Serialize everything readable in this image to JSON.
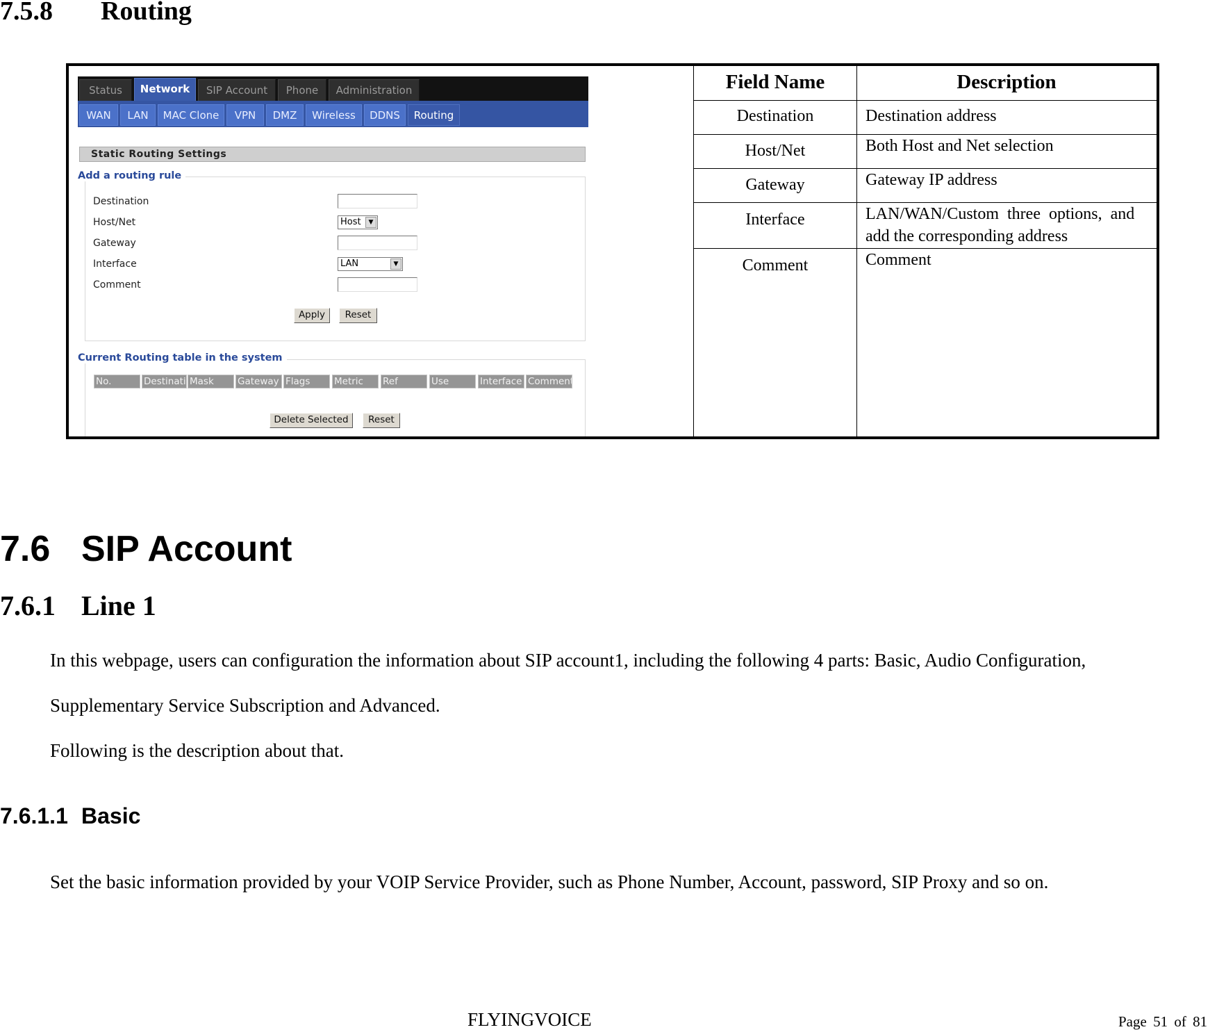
{
  "headings": {
    "routing": {
      "number": "7.5.8",
      "title": "Routing"
    },
    "sip_account": {
      "number": "7.6",
      "title": "SIP Account"
    },
    "line1": {
      "number": "7.6.1",
      "title": "Line 1"
    },
    "basic": {
      "number": "7.6.1.1",
      "title": "Basic"
    }
  },
  "router_ui": {
    "top_tabs": [
      {
        "label": "Status",
        "active": false
      },
      {
        "label": "Network",
        "active": true
      },
      {
        "label": "SIP Account",
        "active": false
      },
      {
        "label": "Phone",
        "active": false
      },
      {
        "label": "Administration",
        "active": false
      }
    ],
    "sub_tabs": [
      {
        "label": "WAN",
        "active": false
      },
      {
        "label": "LAN",
        "active": false
      },
      {
        "label": "MAC Clone",
        "active": false
      },
      {
        "label": "VPN",
        "active": false
      },
      {
        "label": "DMZ",
        "active": false
      },
      {
        "label": "Wireless",
        "active": false
      },
      {
        "label": "DDNS",
        "active": false
      },
      {
        "label": "Routing",
        "active": true
      }
    ],
    "section_title": "Static Routing Settings",
    "add_rule": {
      "legend": "Add a routing rule",
      "fields": {
        "destination": {
          "label": "Destination",
          "value": ""
        },
        "host_net": {
          "label": "Host/Net",
          "value": "Host"
        },
        "gateway": {
          "label": "Gateway",
          "value": ""
        },
        "interface": {
          "label": "Interface",
          "value": "LAN"
        },
        "comment": {
          "label": "Comment",
          "value": ""
        }
      },
      "apply_label": "Apply",
      "reset_label": "Reset"
    },
    "routing_table": {
      "legend": "Current Routing table in the system",
      "columns": [
        "No.",
        "Destination",
        "Mask",
        "Gateway",
        "Flags",
        "Metric",
        "Ref",
        "Use",
        "Interface",
        "Comment"
      ],
      "rows": [],
      "delete_label": "Delete Selected",
      "reset_label": "Reset"
    }
  },
  "field_table": {
    "headers": {
      "name": "Field Name",
      "description": "Description"
    },
    "rows": [
      {
        "name": "Destination",
        "description": "Destination address"
      },
      {
        "name": "Host/Net",
        "description": "Both Host and Net selection"
      },
      {
        "name": "Gateway",
        "description": "Gateway IP address"
      },
      {
        "name": "Interface",
        "description_line1": "LAN/WAN/Custom  three  options,  and",
        "description_line2": "add the corresponding address"
      },
      {
        "name": "Comment",
        "description": "Comment"
      }
    ]
  },
  "paragraphs": {
    "intro_line1": "In this webpage, users can configuration the information about SIP account1, including the following 4 parts: Basic, Audio Configuration,",
    "intro_line2": "Supplementary Service Subscription and Advanced.",
    "intro_line3": "Following is the description about that.",
    "basic_desc": "Set the basic information provided by your VOIP Service Provider, such as Phone Number, Account, password, SIP Proxy and so on."
  },
  "footer": {
    "brand": "FLYINGVOICE",
    "page_label": "Page",
    "page_current": "51",
    "page_of": "of",
    "page_total": "81"
  }
}
